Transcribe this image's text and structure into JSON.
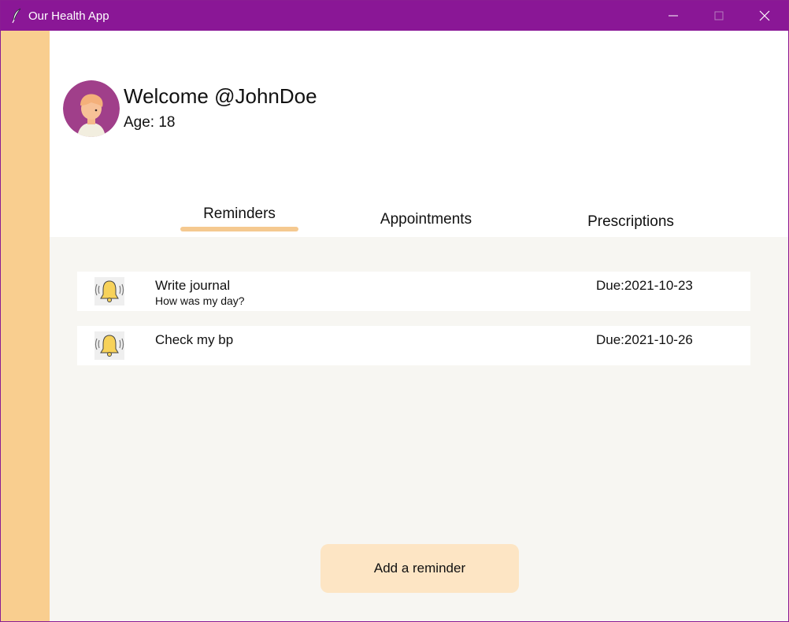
{
  "window": {
    "title": "Our Health App",
    "icon": "feather-icon",
    "controls": [
      "minimize-icon",
      "maximize-icon",
      "close-icon"
    ]
  },
  "profile": {
    "welcome": "Welcome @JohnDoe",
    "age": "Age: 18"
  },
  "tabs": [
    {
      "label": "Reminders",
      "active": true
    },
    {
      "label": "Appointments",
      "active": false
    },
    {
      "label": "Prescriptions",
      "active": false
    }
  ],
  "reminders": [
    {
      "title": "Write journal",
      "note": "How was my day?",
      "due": "Due:2021-10-23",
      "icon": "bell-icon"
    },
    {
      "title": "Check my bp",
      "note": "",
      "due": "Due:2021-10-26",
      "icon": "bell-icon"
    }
  ],
  "actions": {
    "add_label": "Add a reminder"
  },
  "colors": {
    "titlebar": "#8a1796",
    "sidebar": "#f9ce8f",
    "content_bg": "#f7f6f2",
    "tab_indicator": "#f5c990",
    "button_bg": "#fde5c4",
    "avatar_bg": "#a03f8a"
  }
}
